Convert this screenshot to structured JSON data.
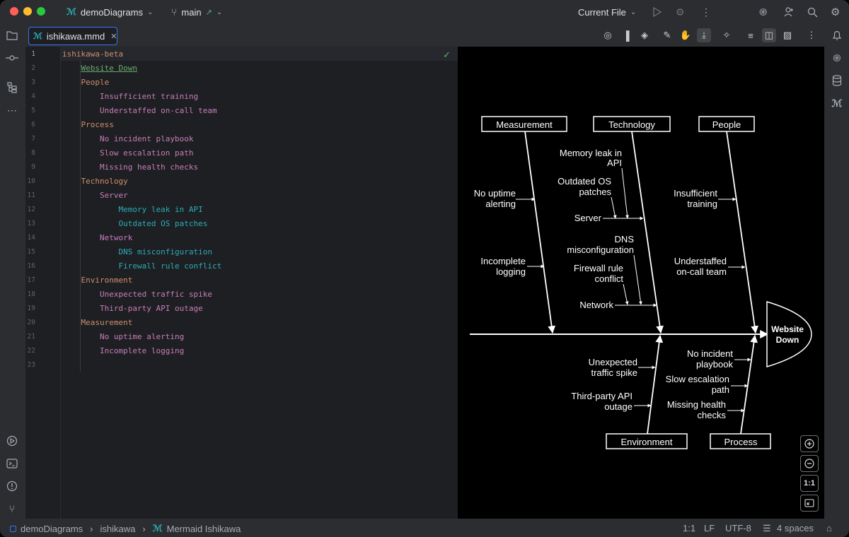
{
  "titlebar": {
    "project": "demoDiagrams",
    "branch": "main",
    "run_config": "Current File"
  },
  "tab": {
    "label": "ishikawa.mmd"
  },
  "editor": {
    "lines": [
      {
        "n": "1",
        "text": "ishikawa-beta",
        "indent": 0,
        "color": "#cf8e6d"
      },
      {
        "n": "2",
        "text": "Website Down",
        "indent": 1,
        "color": "#6aab73"
      },
      {
        "n": "3",
        "text": "People",
        "indent": 1,
        "color": "#cf8e6d"
      },
      {
        "n": "4",
        "text": "Insufficient training",
        "indent": 2,
        "color": "#c77dbb"
      },
      {
        "n": "5",
        "text": "Understaffed on-call team",
        "indent": 2,
        "color": "#c77dbb"
      },
      {
        "n": "6",
        "text": "Process",
        "indent": 1,
        "color": "#cf8e6d"
      },
      {
        "n": "7",
        "text": "No incident playbook",
        "indent": 2,
        "color": "#c77dbb"
      },
      {
        "n": "8",
        "text": "Slow escalation path",
        "indent": 2,
        "color": "#c77dbb"
      },
      {
        "n": "9",
        "text": "Missing health checks",
        "indent": 2,
        "color": "#c77dbb"
      },
      {
        "n": "10",
        "text": "Technology",
        "indent": 1,
        "color": "#cf8e6d"
      },
      {
        "n": "11",
        "text": "Server",
        "indent": 2,
        "color": "#c77dbb"
      },
      {
        "n": "12",
        "text": "Memory leak in API",
        "indent": 3,
        "color": "#2aacb8"
      },
      {
        "n": "13",
        "text": "Outdated OS patches",
        "indent": 3,
        "color": "#2aacb8"
      },
      {
        "n": "14",
        "text": "Network",
        "indent": 2,
        "color": "#c77dbb"
      },
      {
        "n": "15",
        "text": "DNS misconfiguration",
        "indent": 3,
        "color": "#2aacb8"
      },
      {
        "n": "16",
        "text": "Firewall rule conflict",
        "indent": 3,
        "color": "#2aacb8"
      },
      {
        "n": "17",
        "text": "Environment",
        "indent": 1,
        "color": "#cf8e6d"
      },
      {
        "n": "18",
        "text": "Unexpected traffic spike",
        "indent": 2,
        "color": "#c77dbb"
      },
      {
        "n": "19",
        "text": "Third-party API outage",
        "indent": 2,
        "color": "#c77dbb"
      },
      {
        "n": "20",
        "text": "Measurement",
        "indent": 1,
        "color": "#cf8e6d"
      },
      {
        "n": "21",
        "text": "No uptime alerting",
        "indent": 2,
        "color": "#c77dbb"
      },
      {
        "n": "22",
        "text": "Incomplete logging",
        "indent": 2,
        "color": "#c77dbb"
      },
      {
        "n": "23",
        "text": "",
        "indent": 0,
        "color": "#bcbec4"
      }
    ]
  },
  "diagram": {
    "effect": [
      "Website",
      "Down"
    ],
    "categories": {
      "measurement": "Measurement",
      "technology": "Technology",
      "people": "People",
      "environment": "Environment",
      "process": "Process"
    },
    "causes": {
      "no_uptime": [
        "No uptime",
        "alerting"
      ],
      "incomplete_logging": [
        "Incomplete",
        "logging"
      ],
      "memory_leak": [
        "Memory leak in",
        "API"
      ],
      "outdated_os": [
        "Outdated OS",
        "patches"
      ],
      "server": "Server",
      "dns": [
        "DNS",
        "misconfiguration"
      ],
      "firewall": [
        "Firewall rule",
        "conflict"
      ],
      "network": "Network",
      "insufficient_training": [
        "Insufficient",
        "training"
      ],
      "understaffed": [
        "Understaffed",
        "on-call team"
      ],
      "unexpected_traffic": [
        "Unexpected",
        "traffic spike"
      ],
      "third_party": [
        "Third-party API",
        "outage"
      ],
      "no_playbook": [
        "No incident",
        "playbook"
      ],
      "slow_escalation": [
        "Slow escalation",
        "path"
      ],
      "missing_health": [
        "Missing health",
        "checks"
      ]
    }
  },
  "zoom": {
    "reset": "1:1"
  },
  "statusbar": {
    "crumb_project": "demoDiagrams",
    "crumb_folder": "ishikawa",
    "crumb_lang": "Mermaid Ishikawa",
    "position": "1:1",
    "line_sep": "LF",
    "encoding": "UTF-8",
    "indent": "4 spaces"
  },
  "colors": {
    "accent": "#3574f0",
    "keyword": "#cf8e6d",
    "string": "#6aab73",
    "child": "#c77dbb",
    "leaf": "#2aacb8"
  }
}
